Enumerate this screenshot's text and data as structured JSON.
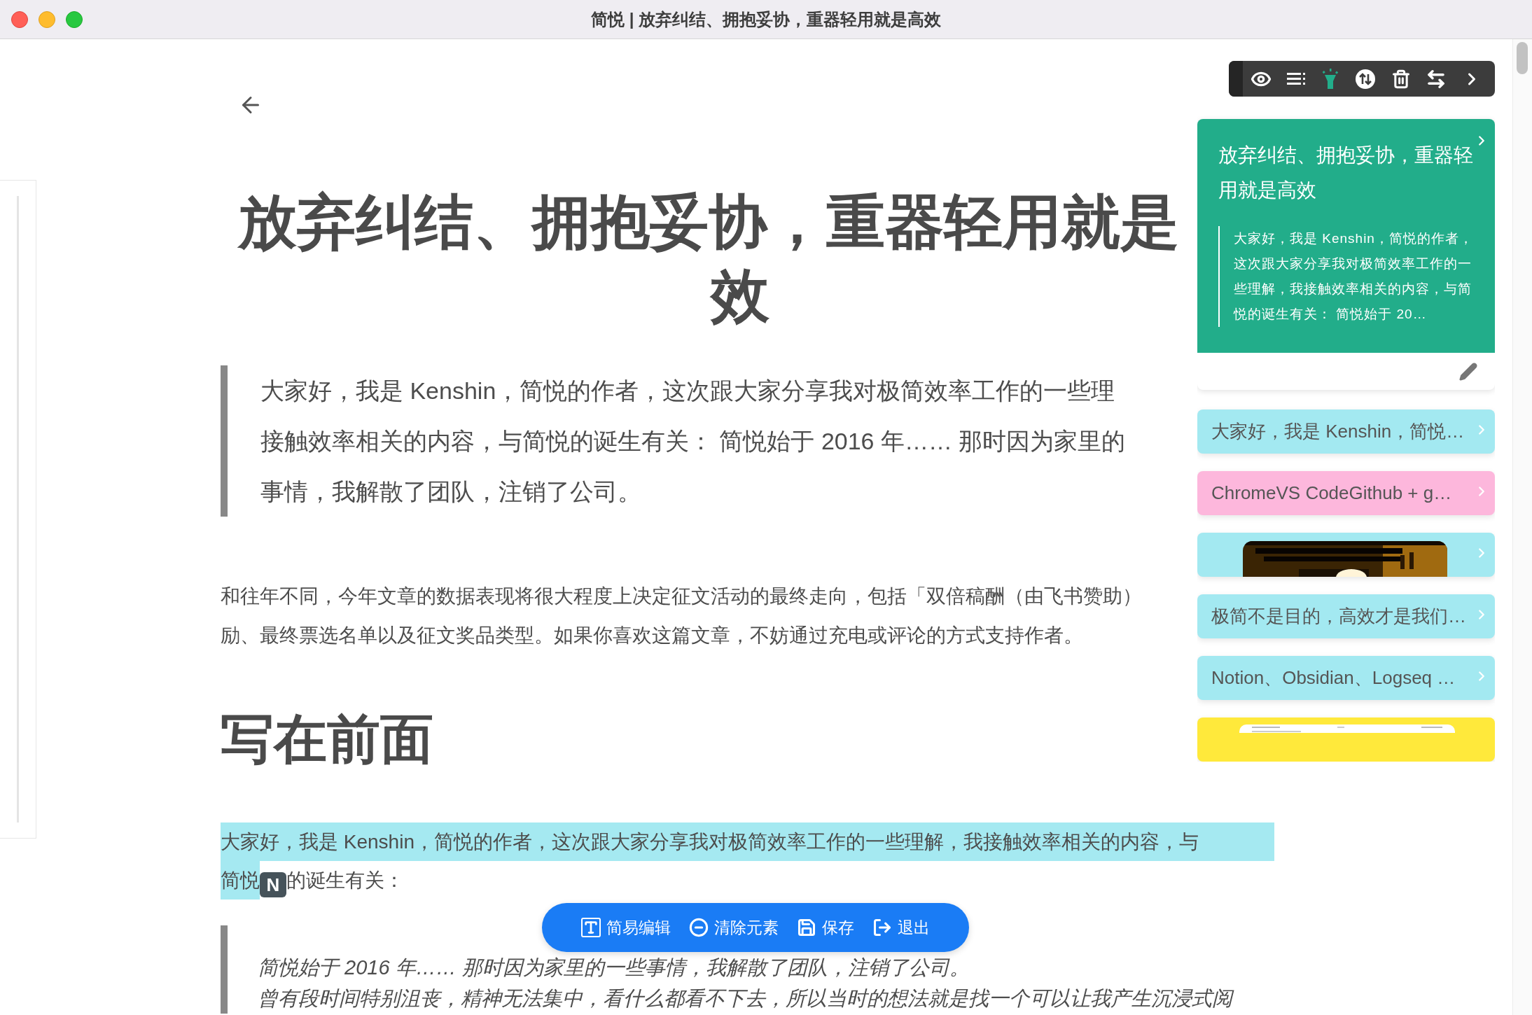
{
  "window": {
    "title": "简悦 | 放弃纠结、拥抱妥协，重器轻用就是高效"
  },
  "article": {
    "heading_lines": [
      "放弃纠结、拥抱妥协，重器轻用就是",
      "效"
    ],
    "intro_quote_lines": [
      "大家好，我是 Kenshin，简悦的作者，这次跟大家分享我对极简效率工作的一些理",
      "接触效率相关的内容，与简悦的诞生有关： 简悦始于 2016 年…… 那时因为家里的",
      "事情，我解散了团队，注销了公司。"
    ],
    "notice_lines": [
      "和往年不同，今年文章的数据表现将很大程度上决定征文活动的最终走向，包括「双倍稿酬（由飞书赞助）",
      "励、最终票选名单以及征文奖品类型。如果你喜欢这篇文章，不妨通过充电或评论的方式支持作者。"
    ],
    "section_heading": "写在前面",
    "highlight": {
      "line_1": "大家好，我是 Kenshin，简悦的作者，这次跟大家分享我对极简效率工作的一些理解，我接触效率相关的内容，与",
      "line_2_marked": "简悦",
      "badge": "N",
      "line_2_rest": "的诞生有关："
    },
    "quote_lines": [
      "简悦始于 2016 年…… 那时因为家里的一些事情，我解散了团队，注销了公司。",
      "曾有段时间特别沮丧，精神无法集中，看什么都看不下去，所以当时的想法就是找一个可以让我产生沉浸式阅"
    ]
  },
  "side_panel": {
    "tools": [
      {
        "kind": "eye",
        "selected": false
      },
      {
        "kind": "list",
        "selected": false
      },
      {
        "kind": "flashlight",
        "selected": true
      },
      {
        "kind": "sort",
        "selected": false
      },
      {
        "kind": "trash",
        "selected": false
      },
      {
        "kind": "swap",
        "selected": false
      },
      {
        "kind": "next",
        "selected": false
      }
    ],
    "summary_card": {
      "title": "放弃纠结、拥抱妥协，重器轻用就是高效",
      "excerpt": "大家好，我是 Kenshin，简悦的作者，这次跟大家分享我对极简效率工作的一些理解，我接触效率相关的内容，与简悦的诞生有关： 简悦始于 20…"
    },
    "cards": [
      {
        "kind": "text",
        "text": "大家好，我是 Kenshin，简悦…",
        "color": "#a3e9f1"
      },
      {
        "kind": "text",
        "text": "ChromeVS CodeGithub + g…",
        "color": "#fdb7dc"
      },
      {
        "kind": "picture",
        "color": "#a3e9f1"
      },
      {
        "kind": "text",
        "text": "极简不是目的，高效才是我们…",
        "color": "#a3e9f1"
      },
      {
        "kind": "text",
        "text": "Notion、Obsidian、Logseq …",
        "color": "#a3e9f1"
      },
      {
        "kind": "screenshot",
        "color": "#ffe93b"
      }
    ]
  },
  "floating_toolbar": [
    {
      "kind": "edit",
      "label": "简易编辑"
    },
    {
      "kind": "clear",
      "label": "清除元素"
    },
    {
      "kind": "save",
      "label": "保存"
    },
    {
      "kind": "exit",
      "label": "退出"
    }
  ]
}
